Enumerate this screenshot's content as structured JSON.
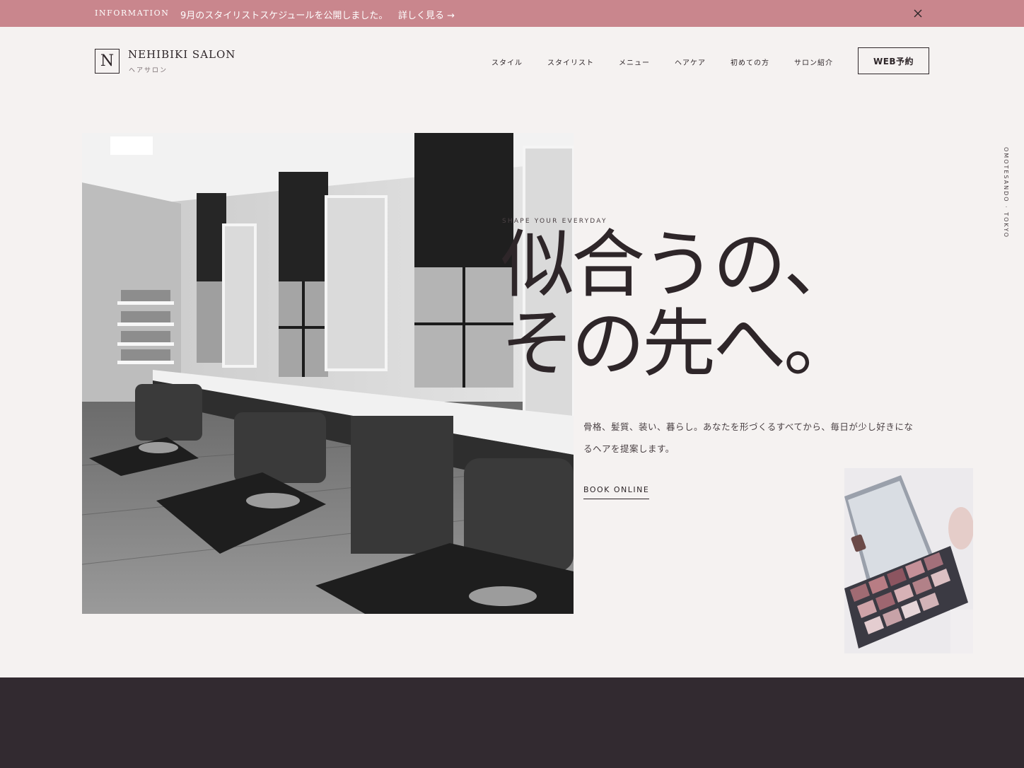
{
  "info_bar": {
    "label": "INFORMATION",
    "text": "9月のスタイリストスケジュールを公開しました。",
    "link": "詳しく見る →"
  },
  "header": {
    "logo_letter": "N",
    "logo_name": "NEHIBIKI SALON",
    "logo_sub": "ヘアサロン",
    "nav": [
      "スタイル",
      "スタイリスト",
      "メニュー",
      "ヘアケア",
      "初めての方",
      "サロン紹介"
    ],
    "cta": "WEB予約"
  },
  "hero": {
    "tagline": "SHAPE YOUR EVERYDAY",
    "headline_line1": "似合うの、",
    "headline_line2": "その先へ。",
    "lead": "骨格、髪質、装い、暮らし。あなたを形づくるすべてから、毎日が少し好きになるヘアを提案します。",
    "book": "BOOK ONLINE",
    "location": "OMOTESANDO · TOKYO"
  },
  "colors": {
    "accent": "#c9868d",
    "background": "#f5f2f1",
    "text": "#2e2629",
    "dark_band": "#322a30"
  }
}
